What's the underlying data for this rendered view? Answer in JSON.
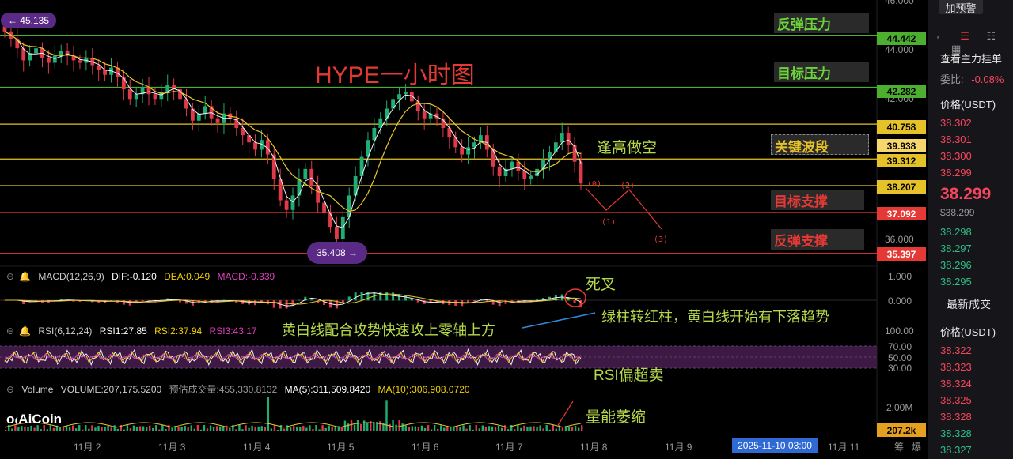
{
  "chart_data": {
    "type": "candlestick",
    "title": "HYPE一小时图",
    "x_labels": [
      "11月 2",
      "11月 3",
      "11月 4",
      "11月 5",
      "11月 6",
      "11月 7",
      "11月 8",
      "11月 9",
      "11月 10",
      "11月 11"
    ],
    "cursor_time": "2025-11-10 03:00",
    "bottom_right_tabs": [
      "筹",
      "爆"
    ],
    "y_axis_ticks": [
      "46.000",
      "44.000",
      "42.000",
      "36.000"
    ],
    "y_range": [
      34.9,
      46.1
    ],
    "close_series": [
      44.6,
      44.3,
      43.9,
      43.4,
      43.7,
      43.9,
      43.5,
      43.3,
      43.6,
      43.8,
      43.6,
      43.4,
      43.3,
      43.5,
      43.2,
      43.0,
      42.8,
      43.1,
      42.7,
      42.2,
      41.8,
      42.0,
      42.3,
      42.0,
      41.8,
      42.1,
      42.4,
      42.2,
      41.8,
      41.4,
      40.9,
      41.2,
      41.5,
      41.0,
      40.8,
      41.2,
      41.0,
      40.6,
      40.3,
      40.0,
      39.7,
      40.1,
      39.5,
      38.5,
      37.6,
      37.2,
      37.8,
      38.5,
      38.9,
      38.2,
      37.5,
      37.1,
      36.5,
      36.0,
      36.9,
      37.8,
      38.6,
      39.4,
      40.1,
      40.6,
      41.0,
      41.4,
      41.8,
      42.0,
      42.1,
      41.7,
      41.3,
      41.0,
      41.2,
      41.0,
      40.6,
      40.2,
      39.8,
      39.5,
      39.8,
      40.0,
      40.3,
      39.7,
      39.0,
      38.6,
      38.9,
      39.2,
      38.8,
      38.5,
      38.6,
      38.9,
      39.3,
      39.6,
      40.0,
      40.4,
      39.9,
      39.2,
      38.3
    ],
    "price_levels": [
      {
        "value": 44.442,
        "label": "44.442",
        "color": "#4caf30",
        "note": "反弹压力"
      },
      {
        "value": 42.282,
        "label": "42.282",
        "color": "#4caf30",
        "note": "目标压力"
      },
      {
        "value": 40.758,
        "label": "40.758",
        "color": "#e6c229",
        "note": ""
      },
      {
        "value": 39.312,
        "label": "39.312",
        "color": "#e6c229",
        "note": ""
      },
      {
        "value": 38.207,
        "label": "38.207",
        "color": "#e6c229",
        "note": ""
      },
      {
        "value": 37.092,
        "label": "37.092",
        "color": "#e53935",
        "note": "目标支撑"
      },
      {
        "value": 35.397,
        "label": "35.397",
        "color": "#e53935",
        "note": "反弹支撑"
      }
    ],
    "current_price_tag": "39.938",
    "current_price_value": 39.938,
    "bottom_volume_tag": "207.2k",
    "key_band_note": "关键波段",
    "high_marker": "← 45.135",
    "low_marker": "35.408 →",
    "wave_labels": [
      "(0)",
      "(1)",
      "(2)",
      "(3)"
    ],
    "macd": {
      "label": "MACD(12,26,9)",
      "dif": "DIF:-0.120",
      "dea": "DEA:0.049",
      "macd": "MACD:-0.339",
      "ticks": [
        "1.000",
        "0.000"
      ]
    },
    "rsi": {
      "label": "RSI(6,12,24)",
      "rsi1": "RSI1:27.85",
      "rsi2": "RSI2:37.94",
      "rsi3": "RSI3:43.17",
      "ticks": [
        "100.00",
        "70.00",
        "50.00",
        "30.00"
      ]
    },
    "volume": {
      "label": "Volume",
      "vol": "VOLUME:207,175.5200",
      "est": "预估成交量:455,330.8132",
      "ma5": "MA(5):311,509.8420",
      "ma10": "MA(10):306,908.0720",
      "ticks": [
        "2.00M"
      ]
    }
  },
  "annotations": {
    "short": "逢高做空",
    "death_cross": "死叉",
    "macd_note": "黄白线配合攻势快速攻上零轴上方",
    "macd_note2": "绿柱转红柱，黄白线开始有下落趋势",
    "rsi_note": "RSI偏超卖",
    "vol_note": "量能萎缩"
  },
  "brand": "AiCoin",
  "right_panel": {
    "alert_button": "加预警",
    "title": "查看主力挂单",
    "ratio_label": "委比:",
    "ratio_value": "-0.08%",
    "price_header": "价格(USDT)",
    "asks": [
      "38.302",
      "38.301",
      "38.300",
      "38.299"
    ],
    "last_price": "38.299",
    "last_price_usd": "$38.299",
    "bids": [
      "38.298",
      "38.297",
      "38.296",
      "38.295"
    ],
    "trades_title": "最新成交",
    "trades_header": "价格(USDT)",
    "trades": [
      "38.322",
      "38.323",
      "38.324",
      "38.325",
      "38.328",
      "38.328",
      "38.327"
    ],
    "colors": {
      "up": "#2ebd85",
      "down": "#f6465d"
    }
  }
}
